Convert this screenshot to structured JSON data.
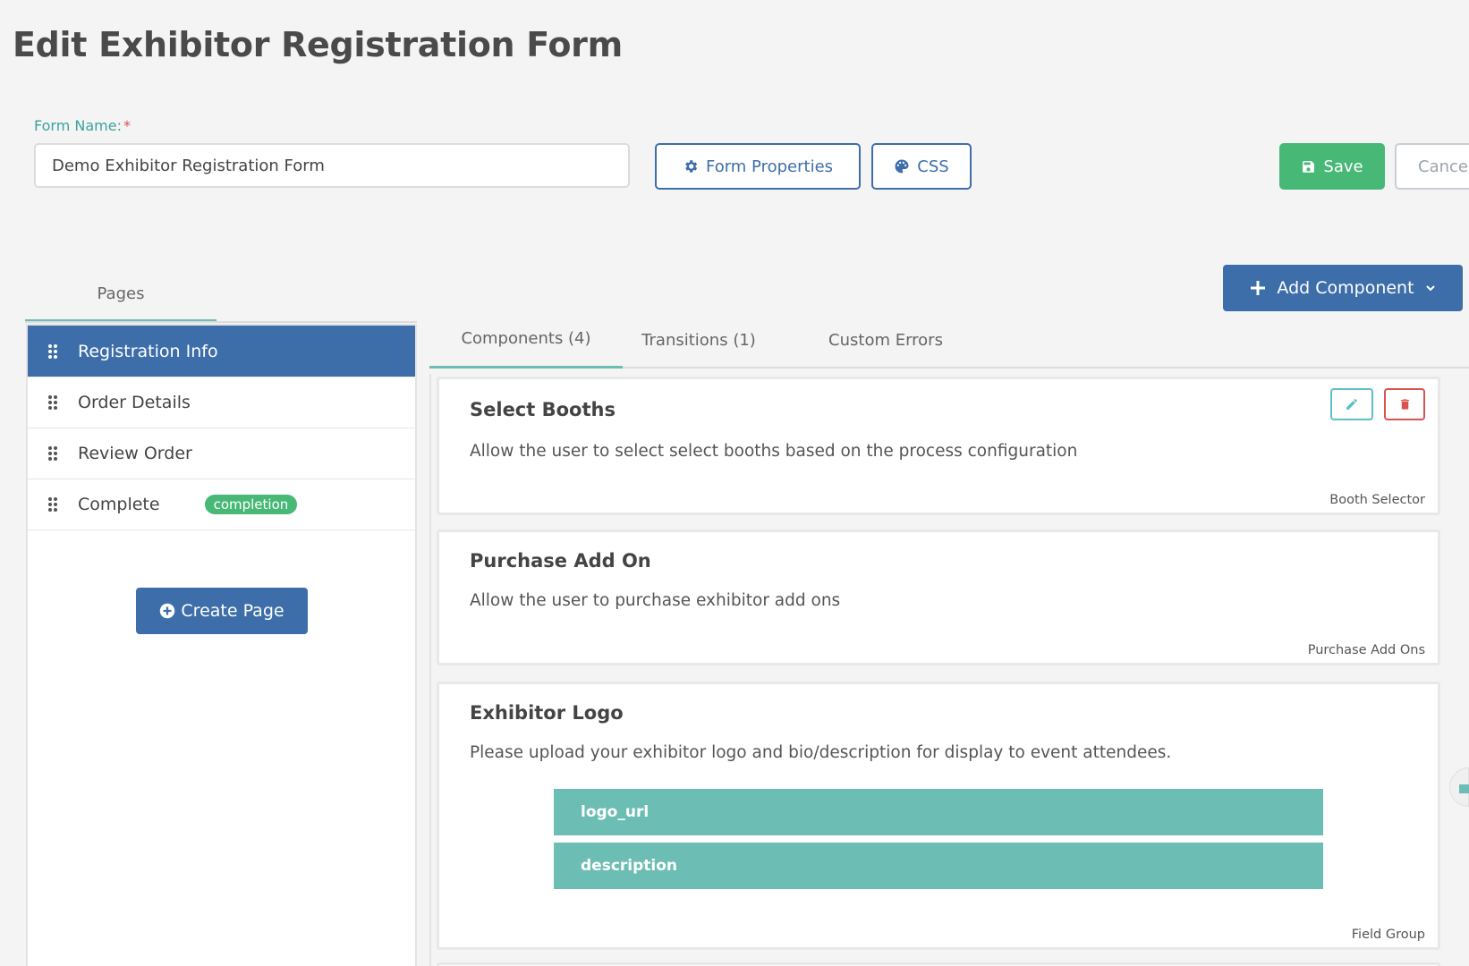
{
  "page": {
    "title": "Edit Exhibitor Registration Form"
  },
  "form": {
    "name_label": "Form Name:",
    "required_mark": "*",
    "name_value": "Demo Exhibitor Registration Form"
  },
  "toolbar": {
    "properties_label": "Form Properties",
    "css_label": "CSS",
    "save_label": "Save",
    "cancel_label": "Cance"
  },
  "pages": {
    "tab_label": "Pages",
    "items": [
      {
        "label": "Registration Info",
        "active": true
      },
      {
        "label": "Order Details"
      },
      {
        "label": "Review Order"
      },
      {
        "label": "Complete",
        "badge": "completion"
      }
    ],
    "create_label": "Create Page"
  },
  "components": {
    "add_label": "Add Component",
    "tabs": [
      {
        "label": "Components (4)",
        "active": true
      },
      {
        "label": "Transitions (1)"
      },
      {
        "label": "Custom Errors"
      }
    ],
    "cards": [
      {
        "title": "Select Booths",
        "description": "Allow the user to select select booths based on the process configuration",
        "type": "Booth Selector"
      },
      {
        "title": "Purchase Add On",
        "description": "Allow the user to purchase exhibitor add ons",
        "type": "Purchase Add Ons"
      },
      {
        "title": "Exhibitor Logo",
        "description": "Please upload your exhibitor logo and bio/description for display to event attendees.",
        "fields": [
          "logo_url",
          "description"
        ],
        "type": "Field Group"
      }
    ]
  },
  "colors": {
    "primary": "#3d6ea9",
    "success": "#48b877",
    "teal": "#6cbdb3",
    "danger": "#d9534f"
  }
}
